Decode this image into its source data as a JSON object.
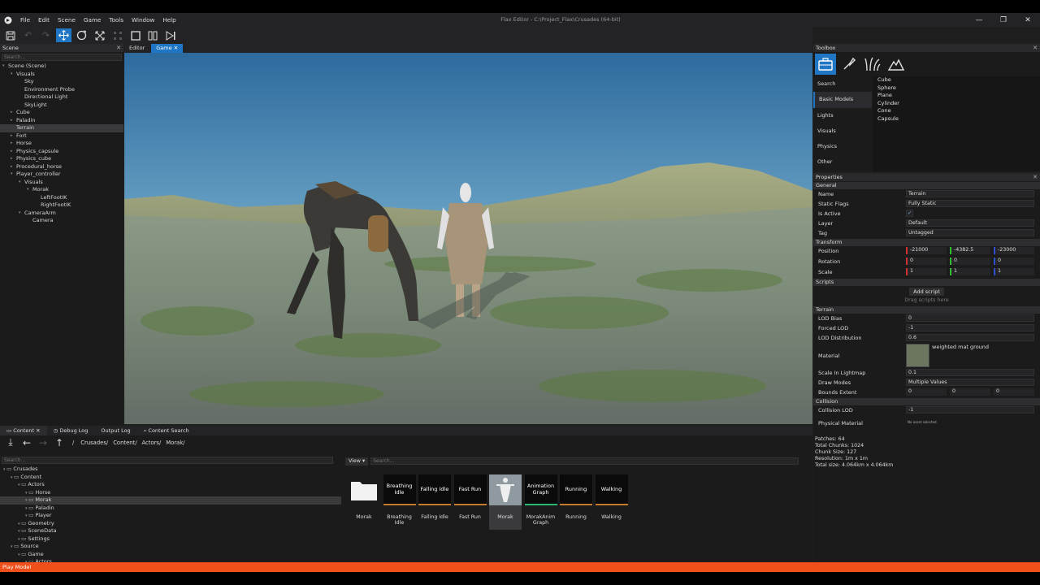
{
  "window": {
    "title": "Flax Editor - C:\\Project_Flax\\Crusades (64-bit)",
    "minimize": "—",
    "maximize": "❐",
    "close": "✕"
  },
  "menu": [
    "File",
    "Edit",
    "Scene",
    "Game",
    "Tools",
    "Window",
    "Help"
  ],
  "toolbar": {
    "icons": [
      "save-icon",
      "undo-icon",
      "redo-icon",
      "translate-icon",
      "rotate-icon",
      "scale-icon",
      "snap-icon",
      "play-icon",
      "pause-icon",
      "step-icon"
    ]
  },
  "scene": {
    "header": "Scene",
    "search_placeholder": "Search...",
    "items": [
      {
        "label": "Scene (Scene)",
        "depth": 0,
        "expanded": true
      },
      {
        "label": "Visuals",
        "depth": 1,
        "expanded": true
      },
      {
        "label": "Sky",
        "depth": 2
      },
      {
        "label": "Environment Probe",
        "depth": 2
      },
      {
        "label": "Directional Light",
        "depth": 2
      },
      {
        "label": "SkyLight",
        "depth": 2
      },
      {
        "label": "Cube",
        "depth": 1,
        "collapsed": true
      },
      {
        "label": "Paladin",
        "depth": 1,
        "collapsed": true
      },
      {
        "label": "Terrain",
        "depth": 1,
        "selected": true
      },
      {
        "label": "Fort",
        "depth": 1,
        "collapsed": true
      },
      {
        "label": "Horse",
        "depth": 1,
        "collapsed": true
      },
      {
        "label": "Physics_capsule",
        "depth": 1,
        "collapsed": true
      },
      {
        "label": "Physics_cube",
        "depth": 1,
        "collapsed": true
      },
      {
        "label": "Procedural_horse",
        "depth": 1,
        "collapsed": true
      },
      {
        "label": "Player_controller",
        "depth": 1,
        "expanded": true
      },
      {
        "label": "Visuals",
        "depth": 2,
        "expanded": true
      },
      {
        "label": "Morak",
        "depth": 3,
        "expanded": true
      },
      {
        "label": "LeftFootIK",
        "depth": 4
      },
      {
        "label": "RightFootIK",
        "depth": 4
      },
      {
        "label": "CameraArm",
        "depth": 2,
        "expanded": true
      },
      {
        "label": "Camera",
        "depth": 3
      }
    ]
  },
  "viewport": {
    "tabs": [
      "Editor",
      "Game"
    ],
    "active_tab": "Game"
  },
  "toolbox": {
    "header": "Toolbox",
    "icons": [
      "toolbox-icon",
      "paint-icon",
      "foliage-icon",
      "terrain-icon"
    ],
    "categories": [
      "Search",
      "Basic Models",
      "Lights",
      "Visuals",
      "Physics",
      "Other"
    ],
    "active_category": "Basic Models",
    "items": [
      "Cube",
      "Sphere",
      "Plane",
      "Cylinder",
      "Cone",
      "Capsule"
    ]
  },
  "properties": {
    "header": "Properties",
    "general": {
      "section": "General",
      "name_label": "Name",
      "name": "Terrain",
      "static_flags_label": "Static Flags",
      "static_flags": "Fully Static",
      "is_active_label": "Is Active",
      "is_active": "✓",
      "layer_label": "Layer",
      "layer": "Default",
      "tag_label": "Tag",
      "tag": "Untagged"
    },
    "transform": {
      "section": "Transform",
      "position_label": "Position",
      "position": [
        "-21000",
        "-4382.5",
        "-23000"
      ],
      "rotation_label": "Rotation",
      "rotation": [
        "0",
        "0",
        "0"
      ],
      "scale_label": "Scale",
      "scale": [
        "1",
        "1",
        "1"
      ]
    },
    "scripts": {
      "section": "Scripts",
      "add_button": "Add script",
      "hint": "Drag scripts here"
    },
    "terrain": {
      "section": "Terrain",
      "lod_bias_label": "LOD Bias",
      "lod_bias": "0",
      "forced_lod_label": "Forced LOD",
      "forced_lod": "-1",
      "lod_distribution_label": "LOD Distribution",
      "lod_distribution": "0.6",
      "material_label": "Material",
      "material": "weighted mat ground",
      "scale_lightmap_label": "Scale In Lightmap",
      "scale_lightmap": "0.1",
      "draw_modes_label": "Draw Modes",
      "draw_modes": "Multiple Values",
      "bounds_label": "Bounds Extent",
      "bounds": [
        "0",
        "0",
        "0"
      ]
    },
    "collision": {
      "section": "Collision",
      "collision_lod_label": "Collision LOD",
      "collision_lod": "-1",
      "physical_material_label": "Physical Material",
      "physical_material": "No asset selected"
    },
    "stats": {
      "patches": "Patches: 64",
      "total_chunks": "Total Chunks: 1024",
      "chunk_size": "Chunk Size: 127",
      "resolution": "Resolution: 1m x 1m",
      "total_size": "Total size: 4.064km x 4.064km"
    }
  },
  "content": {
    "tabs": [
      "Content",
      "Debug Log",
      "Output Log",
      "Content Search"
    ],
    "breadcrumb": [
      "Crusades/",
      "Content/",
      "Actors/",
      "Morak/"
    ],
    "search_placeholder": "Search...",
    "view_label": "View",
    "asset_search_placeholder": "Search...",
    "tree": [
      {
        "label": "Crusades",
        "depth": 0
      },
      {
        "label": "Content",
        "depth": 1
      },
      {
        "label": "Actors",
        "depth": 2
      },
      {
        "label": "Horse",
        "depth": 3
      },
      {
        "label": "Morak",
        "depth": 3,
        "selected": true
      },
      {
        "label": "Paladin",
        "depth": 3
      },
      {
        "label": "Player",
        "depth": 3
      },
      {
        "label": "Geometry",
        "depth": 2
      },
      {
        "label": "SceneData",
        "depth": 2
      },
      {
        "label": "Settings",
        "depth": 2
      },
      {
        "label": "Source",
        "depth": 1
      },
      {
        "label": "Game",
        "depth": 2
      },
      {
        "label": "Actors",
        "depth": 3
      }
    ],
    "assets": [
      {
        "thumb": "",
        "name": "Morak",
        "kind": "folder"
      },
      {
        "thumb": "Breathing Idle",
        "name": "Breathing Idle"
      },
      {
        "thumb": "Falling Idle",
        "name": "Falling Idle"
      },
      {
        "thumb": "Fast Run",
        "name": "Fast Run"
      },
      {
        "thumb": "",
        "name": "Morak",
        "kind": "model",
        "selected": true
      },
      {
        "thumb": "Animation Graph",
        "name": "MorakAnimGraph"
      },
      {
        "thumb": "Running",
        "name": "Running"
      },
      {
        "thumb": "Walking",
        "name": "Walking"
      }
    ]
  },
  "status": "Play Mode!"
}
